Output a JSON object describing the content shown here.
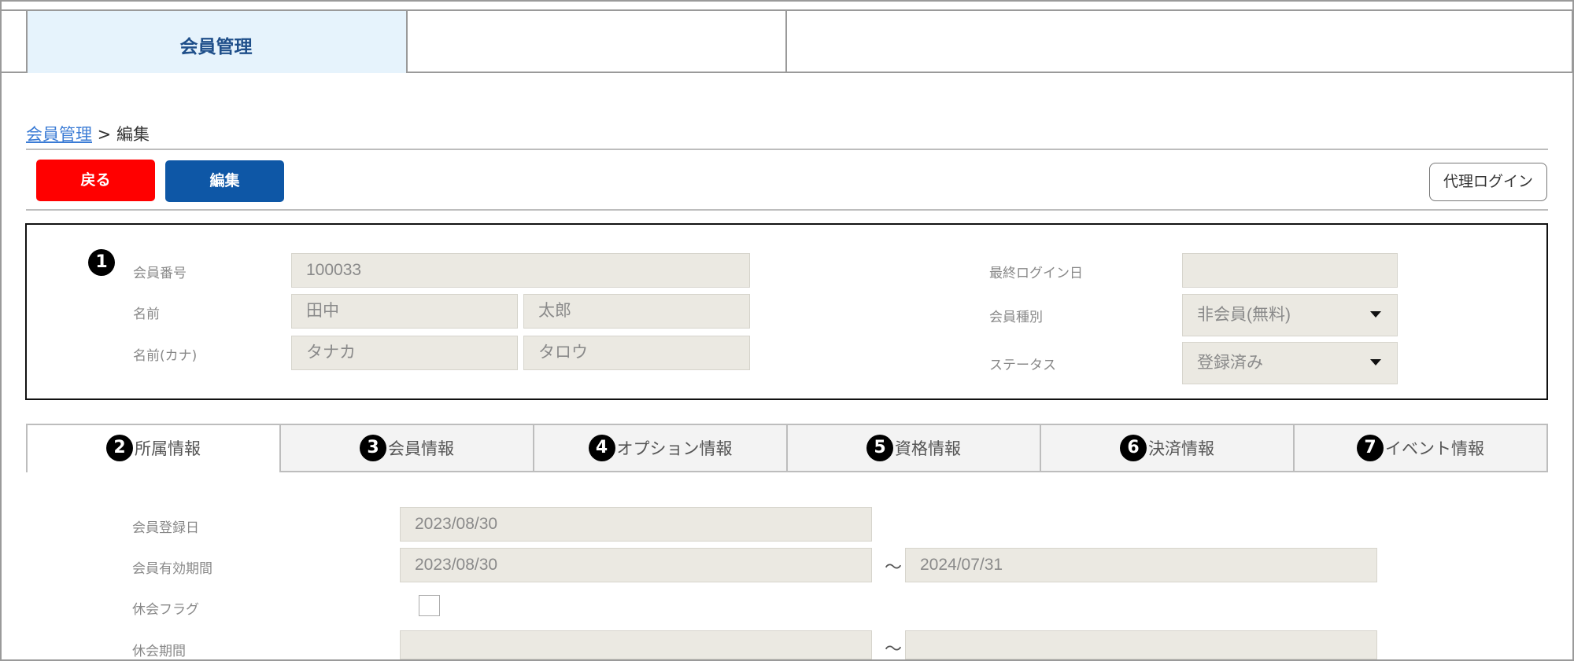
{
  "topnav": {
    "tabs": [
      "会員管理",
      "",
      ""
    ]
  },
  "breadcrumb": {
    "link": "会員管理",
    "separator": " > ",
    "current": "編集"
  },
  "toolbar": {
    "back": "戻る",
    "edit": "編集",
    "proxy_login": "代理ログイン"
  },
  "header_panel": {
    "marker": "1",
    "member_no_label": "会員番号",
    "member_no": "100033",
    "name_label": "名前",
    "last_name": "田中",
    "first_name": "太郎",
    "kana_label": "名前(カナ)",
    "last_kana": "タナカ",
    "first_kana": "タロウ",
    "last_login_label": "最終ログイン日",
    "last_login": "",
    "member_type_label": "会員種別",
    "member_type": "非会員(無料)",
    "status_label": "ステータス",
    "status": "登録済み"
  },
  "tabs": [
    {
      "num": "2",
      "label": "所属情報"
    },
    {
      "num": "3",
      "label": "会員情報"
    },
    {
      "num": "4",
      "label": "オプション情報"
    },
    {
      "num": "5",
      "label": "資格情報"
    },
    {
      "num": "6",
      "label": "決済情報"
    },
    {
      "num": "7",
      "label": "イベント情報"
    }
  ],
  "detail": {
    "reg_date_label": "会員登録日",
    "reg_date": "2023/08/30",
    "valid_label": "会員有効期間",
    "valid_from": "2023/08/30",
    "tilde": "〜",
    "valid_to": "2024/07/31",
    "suspend_flag_label": "休会フラグ",
    "suspend_period_label": "休会期間",
    "suspend_from": "",
    "suspend_to": ""
  },
  "colors": {
    "active_tab_bg": "#e6f3fc",
    "back_button": "#ff0000",
    "edit_button": "#0e57a6",
    "field_bg": "#ebe9e2"
  }
}
